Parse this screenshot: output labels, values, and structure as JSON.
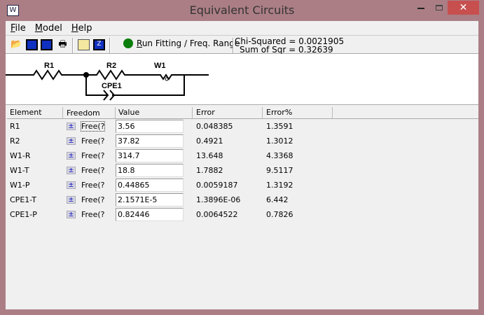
{
  "window": {
    "title": "Equivalent Circuits",
    "app_icon": "W",
    "close": "✕"
  },
  "menu": [
    {
      "label": "File",
      "accel": "F",
      "rest": "ile"
    },
    {
      "label": "Model",
      "accel": "M",
      "rest": "odel"
    },
    {
      "label": "Help",
      "accel": "H",
      "rest": "elp"
    }
  ],
  "toolbar": {
    "run_label": "Run Fitting / Freq. Range",
    "run_accel": "R",
    "run_rest": "un Fitting / Freq. Range",
    "run_color": "#0a7d0a",
    "chi_squared": "Chi-Squared = 0.0021905",
    "sum_of_sqr": "Sum of Sqr = 0.32639"
  },
  "circuit": {
    "labels": {
      "r1": "R1",
      "r2": "R2",
      "w1": "W1",
      "cpe1": "CPE1"
    }
  },
  "table": {
    "headers": [
      "Element",
      "Freedom",
      "Value",
      "Error",
      "Error%"
    ],
    "rows": [
      {
        "element": "R1",
        "freedom": "Free(?",
        "value": "3.56",
        "error": "0.048385",
        "error_pct": "1.3591"
      },
      {
        "element": "R2",
        "freedom": "Free(?",
        "value": "37.82",
        "error": "0.4921",
        "error_pct": "1.3012"
      },
      {
        "element": "W1-R",
        "freedom": "Free(?",
        "value": "314.7",
        "error": "13.648",
        "error_pct": "4.3368"
      },
      {
        "element": "W1-T",
        "freedom": "Free(?",
        "value": "18.8",
        "error": "1.7882",
        "error_pct": "9.5117"
      },
      {
        "element": "W1-P",
        "freedom": "Free(?",
        "value": "0.44865",
        "error": "0.0059187",
        "error_pct": "1.3192"
      },
      {
        "element": "CPE1-T",
        "freedom": "Free(?",
        "value": "2.1571E-5",
        "error": "1.3896E-06",
        "error_pct": "6.442"
      },
      {
        "element": "CPE1-P",
        "freedom": "Free(?",
        "value": "0.82446",
        "error": "0.0064522",
        "error_pct": "0.7826"
      }
    ]
  }
}
